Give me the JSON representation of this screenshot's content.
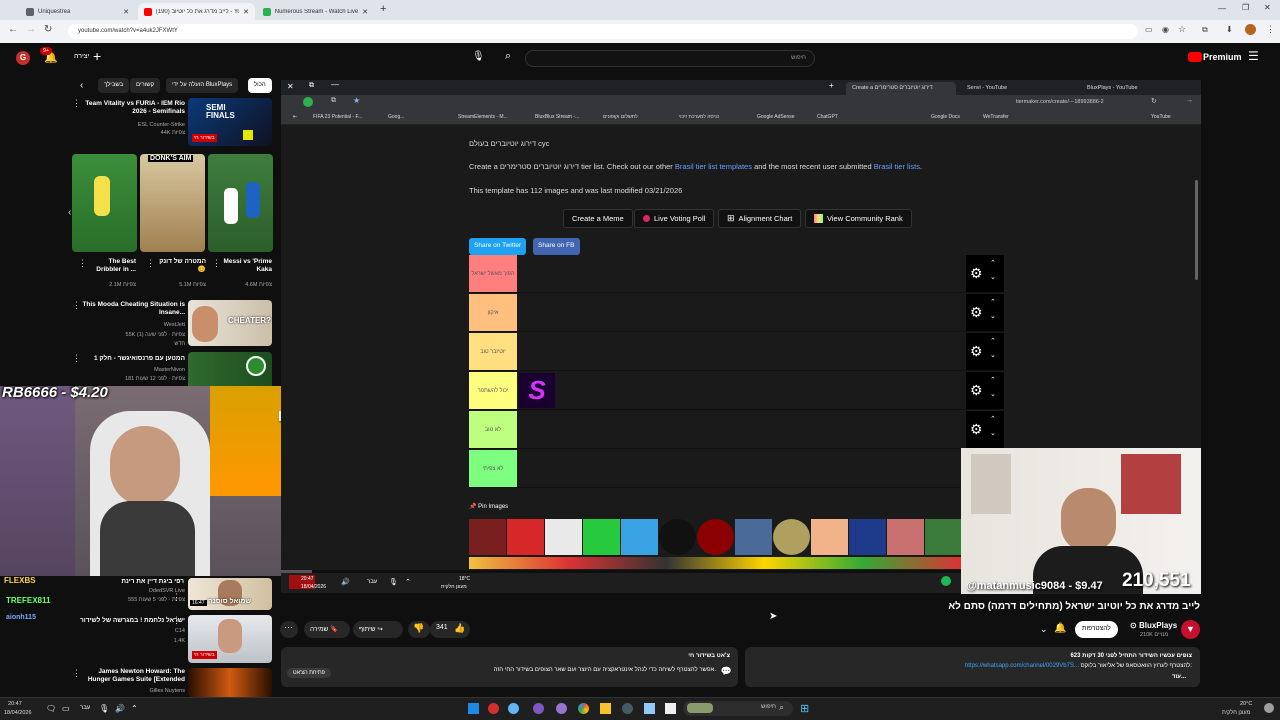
{
  "browser": {
    "tabs": [
      {
        "label": "Uniquestrea",
        "color": "#5f6368",
        "active": false
      },
      {
        "label": "(190) לייב מדרג את כל יוטיוב - YouTube",
        "color": "#ff0000",
        "active": true
      },
      {
        "label": "Numerous Stream - Watch Live",
        "color": "#2bb24c",
        "active": false
      }
    ],
    "url": "youtube.com/watch?v=a4uk2JFXWtY"
  },
  "youtube": {
    "create_label": "יצירה",
    "notif_count": "9+",
    "search_placeholder": "חיפוש",
    "premium_label": "Premium",
    "chips": [
      "הכול",
      "הועלה על ידי BluxPlays",
      "קשורים",
      "בשבילך"
    ],
    "sidebar_top": {
      "title": "Team Vitality vs FURIA - IEM Rio 2026 - Semifinals",
      "channel": "ESL Counter-Strike",
      "views": "44K צפיות",
      "live": "בשידור חי"
    },
    "shorts": [
      {
        "title": "The Best Dribbler in ...",
        "views": "2.1M צפיות"
      },
      {
        "title": "המטרה של דונק 😊",
        "views": "5.1M צפיות"
      },
      {
        "title": "Messi vs 'Prime Kaka",
        "views": "4.6M צפיות"
      }
    ],
    "rec1": {
      "title": "This Mooda Cheating Situation is Insane...",
      "channel": "WestJett",
      "meta": "55K צפיות · לפני שעה (1)",
      "new": "חדש",
      "thumb_text": "CHEATER?"
    },
    "rec2": {
      "title": "המטען עם פרנסואיגשר - חלק 1",
      "channel": "MasterNivon",
      "meta": "181 צפיות · לפני 12 שעות",
      "new": "חדש"
    },
    "rec3": {
      "title": "רפי ביגת דיין את רינת",
      "channel": "OdedSVR Live",
      "meta": "555 צפיות · לפני 5 שעות",
      "thumb_text": "שמואל סוסנה",
      "duration": "16:47"
    },
    "rec4": {
      "title": "ישראל נלחמת ! במגרשה של לשידור",
      "channel": "C14",
      "meta": "1.4K",
      "live": "בשידור חי"
    },
    "rec5": {
      "title": "James Newton Howard: The Hunger Games Suite [Extended",
      "channel": "Gilles Nuytens"
    },
    "main_title": "לייב מדרג את כל יוטיוב ישראל (מתחילים דרמה) סתם לא",
    "channel_name": "BluxPlays",
    "subs": "210K מנויים",
    "subscribe": "להצטרפות",
    "likes": "341",
    "share": "שיתוף",
    "save": "שמירה",
    "desc1": "623 צופים עכשיו השידור התחיל לפני 30 דקות",
    "desc2": "להצטרף לערוץ הוואטסאפ של אליאור בלוקס:",
    "desc_link": "https://whatsapp.com/channel/0029Vb7S...",
    "desc_more": "עוד...",
    "chat_title": "צ'אט בשידור חי",
    "chat_text": "אפשר להצטרף לשיחה כדי לנהל אינטראקציה עם היוצר ועם שאר הצופים בשידור החי הזה.",
    "chat_open": "פתיחת הצ'אט"
  },
  "tiermaker": {
    "tabs": [
      "Create a דירוג יוטיוברים סטרימרים",
      "Senvi - YouTube",
      "BluxPlays - YouTube"
    ],
    "url": "tiermaker.com/create/---18993886-2",
    "bookmarks": [
      "FIFA 23 Potential - F...",
      "Goog...",
      "StreamElements - M...",
      "BluxBlux Stream -...",
      "לתשלום וקופונים",
      "כניסה למערכת זיכוי",
      "Google AdSense",
      "ChatGPT",
      "Google Docs",
      "WeTransfer",
      "YouTube"
    ],
    "heading": "דירוג יוטיוברים בעולם cyc",
    "p1_a": "Create a דירוג יוטיוברים סטרימרים tier list. Check out our other ",
    "p1_link1": "Brasil tier list templates",
    "p1_b": " and the most recent user submitted ",
    "p1_link2": "Brasil tier lists",
    "p1_c": ".",
    "p2": "This template has 112 images and was last modified 03/21/2026",
    "buttons": [
      "Create a Meme",
      "Live Voting Poll",
      "Alignment Chart",
      "View Community Rank"
    ],
    "share_twitter": "Share on Twitter",
    "share_fb": "Share on FB",
    "tiers": [
      {
        "label": "הפוך מאשל ישראל",
        "color": "#ff7f7f"
      },
      {
        "label": "איקון",
        "color": "#ffbf7f"
      },
      {
        "label": "יוטיובר טוב",
        "color": "#ffdf7f"
      },
      {
        "label": "יכול להשתפר",
        "color": "#ffff7f"
      },
      {
        "label": "לא טוב",
        "color": "#bfff7f"
      },
      {
        "label": "לא צפיתי",
        "color": "#7fff7f"
      }
    ],
    "pin_label": "Pin Images"
  },
  "overlays": {
    "donation_top": "RB6666 - $4.20",
    "donation_top_tag": "k655",
    "streamer_bl_lines": [
      "FLEXBS",
      "TREFEX811",
      "aionh115"
    ],
    "donation_bottom": "@matanmusic9084 - $9.47",
    "viewer_count": "210,551"
  },
  "player_bar": {
    "time_left": "20:47",
    "date_left": "18/04/2026",
    "temp": "18°C",
    "weather": "מעונן חלקית",
    "lang": "עבר"
  },
  "taskbar": {
    "time": "20:47",
    "date": "18/04/2026",
    "temp": "20°C",
    "weather": "מעונן חלקית",
    "search": "חיפוש",
    "lang": "עבר"
  }
}
